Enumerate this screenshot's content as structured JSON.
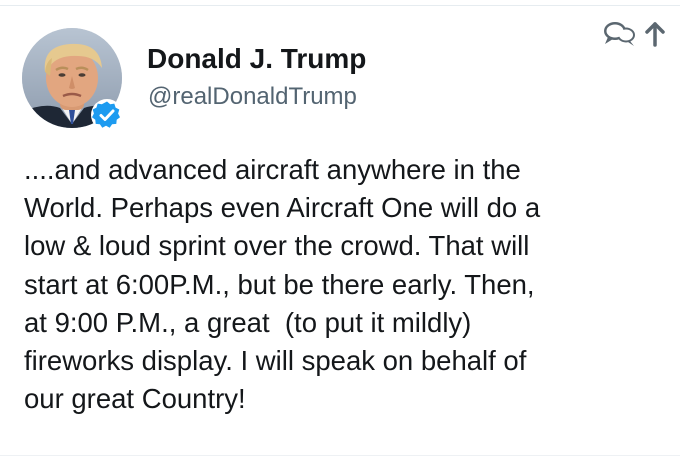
{
  "tweet": {
    "author": {
      "display_name": "Donald J. Trump",
      "handle": "@realDonaldTrump",
      "verified": true,
      "avatar_icon": "profile-photo",
      "verified_icon": "verified-check-icon"
    },
    "header_actions": [
      {
        "icon": "speech-bubbles-icon"
      },
      {
        "icon": "arrow-up-icon"
      }
    ],
    "text_lines": [
      "....and advanced aircraft anywhere in the",
      "World. Perhaps even Aircraft One will do a",
      "low & loud sprint over the crowd. That will",
      "start at 6:00P.M., but be there early. Then,",
      "at 9:00 P.M., a great  (to put it mildly)",
      "fireworks display. I will speak on behalf of",
      "our great Country!"
    ]
  },
  "colors": {
    "text_primary": "#14171a",
    "text_secondary": "#536471",
    "verified_blue": "#1d9bf0",
    "icon_gray": "#5b6770",
    "background": "#ffffff"
  }
}
